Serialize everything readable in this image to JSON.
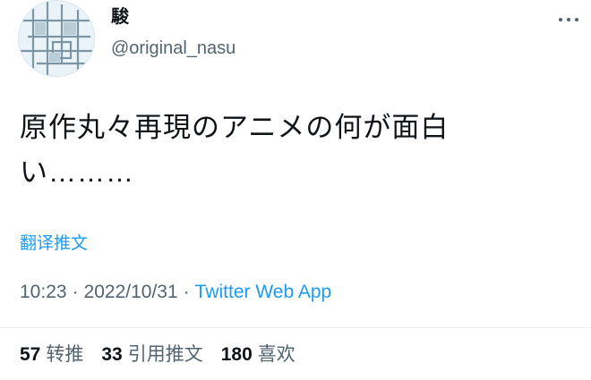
{
  "user": {
    "display_name": "駿",
    "handle": "@original_nasu"
  },
  "icons": {
    "avatar": "avatar-pattern",
    "more": "more-icon"
  },
  "tweet": {
    "text": "原作丸々再現のアニメの何が面白い………",
    "translate_label": "翻译推文",
    "time": "10:23",
    "separator": "·",
    "date": "2022/10/31",
    "client": "Twitter Web App"
  },
  "stats": {
    "retweets_count": "57",
    "retweets_label": "转推",
    "quotes_count": "33",
    "quotes_label": "引用推文",
    "likes_count": "180",
    "likes_label": "喜欢"
  },
  "colors": {
    "link": "#1d9bf0",
    "secondary_text": "#536471",
    "primary_text": "#0f1419"
  }
}
